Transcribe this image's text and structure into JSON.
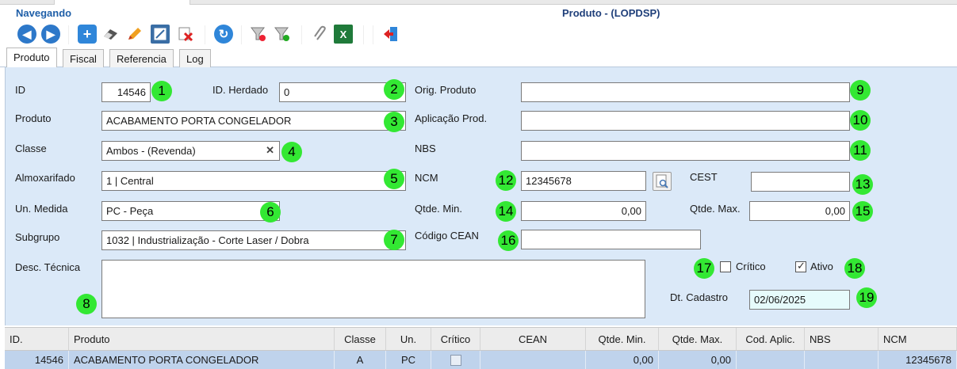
{
  "header": {
    "mode": "Navegando",
    "title": "Produto - (LOPDSP)"
  },
  "toolbar": {
    "buttons": [
      "back-icon",
      "forward-icon",
      "add-icon",
      "eraser-icon",
      "edit-icon",
      "edit-list-icon",
      "delete-icon",
      "refresh-icon",
      "filter-clear-icon",
      "filter-add-icon",
      "attach-icon",
      "excel-icon",
      "exit-icon"
    ]
  },
  "tabs": [
    "Produto",
    "Fiscal",
    "Referencia",
    "Log"
  ],
  "form": {
    "id": {
      "label": "ID",
      "value": "14546",
      "marker": "1"
    },
    "id_herdado": {
      "label": "ID. Herdado",
      "value": "0",
      "marker": "2"
    },
    "produto": {
      "label": "Produto",
      "value": "ACABAMENTO  PORTA CONGELADOR",
      "marker": "3"
    },
    "classe": {
      "label": "Classe",
      "value": "Ambos - (Revenda)",
      "clear": "✕",
      "marker": "4"
    },
    "almoxarifado": {
      "label": "Almoxarifado",
      "value": "1 | Central",
      "marker": "5"
    },
    "un_medida": {
      "label": "Un. Medida",
      "value": "PC - Peça",
      "marker": "6"
    },
    "subgrupo": {
      "label": "Subgrupo",
      "value": "1032 | Industrialização - Corte Laser / Dobra",
      "marker": "7"
    },
    "desc_tecnica": {
      "label": "Desc. Técnica",
      "value": "",
      "marker": "8"
    },
    "orig_produto": {
      "label": "Orig. Produto",
      "value": "",
      "marker": "9"
    },
    "aplicacao_prod": {
      "label": "Aplicação Prod.",
      "value": "",
      "marker": "10"
    },
    "nbs": {
      "label": "NBS",
      "value": "",
      "marker": "11"
    },
    "ncm": {
      "label": "NCM",
      "value": "12345678",
      "marker": "12"
    },
    "cest": {
      "label": "CEST",
      "value": "",
      "marker": "13"
    },
    "qtde_min": {
      "label": "Qtde. Min.",
      "value": "0,00",
      "marker": "14"
    },
    "qtde_max": {
      "label": "Qtde. Max.",
      "value": "0,00",
      "marker": "15"
    },
    "codigo_cean": {
      "label": "Código CEAN",
      "value": "",
      "marker": "16"
    },
    "critico": {
      "label": "Crítico",
      "checked": false,
      "marker": "17"
    },
    "ativo": {
      "label": "Ativo",
      "checked": true,
      "marker": "18"
    },
    "dt_cadastro": {
      "label": "Dt. Cadastro",
      "value": "02/06/2025",
      "marker": "19"
    }
  },
  "grid": {
    "columns": [
      "ID.",
      "Produto",
      "Classe",
      "Un.",
      "Crítico",
      "CEAN",
      "Qtde. Min.",
      "Qtde. Max.",
      "Cod. Aplic.",
      "NBS",
      "NCM"
    ],
    "rows": [
      [
        "14546",
        "ACABAMENTO PORTA CONGELADOR",
        "A",
        "PC",
        "",
        "",
        "0,00",
        "0,00",
        "",
        "",
        "12345678"
      ]
    ]
  },
  "colors": {
    "accent": "#1f5fa8",
    "form_bg": "#dbe9f8",
    "marker": "#33e833",
    "selected_row": "#bfd3ec"
  }
}
